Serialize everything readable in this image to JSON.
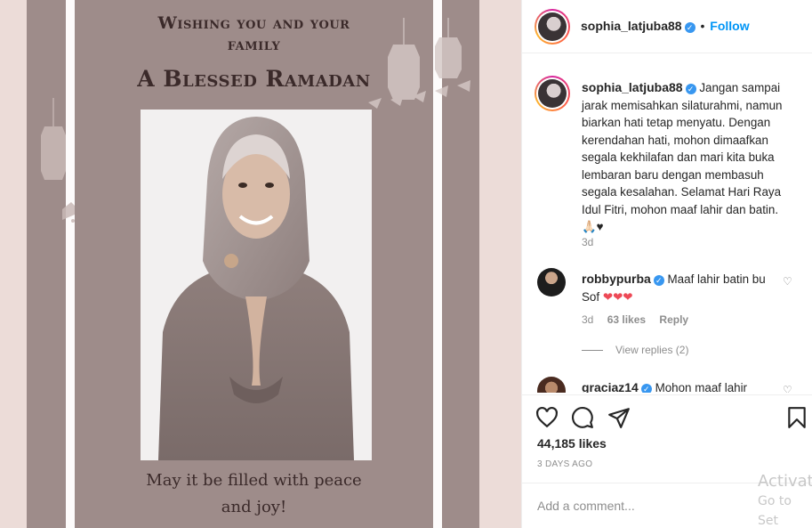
{
  "card": {
    "title_line1": "Wishing you and your",
    "title_line2": "family",
    "title_big": "A Blessed Ramadan",
    "caption_line1": "May it be filled with peace",
    "caption_line2": "and joy!"
  },
  "header": {
    "username": "sophia_latjuba88",
    "separator": "•",
    "follow_label": "Follow"
  },
  "caption": {
    "username": "sophia_latjuba88",
    "text": "Jangan sampai jarak memisahkan silaturahmi, namun biarkan hati tetap menyatu. Dengan kerendahan hati, mohon dimaafkan segala kekhilafan dan mari kita buka lembaran baru dengan membasuh segala kesalahan. Selamat Hari Raya Idul Fitri, mohon maaf lahir dan batin.",
    "emoji": "🙏🏻♥",
    "age": "3d"
  },
  "comments": [
    {
      "username": "robbypurba",
      "text": "Maaf lahir batin bu Sof",
      "emoji": "❤❤❤",
      "age": "3d",
      "likes": "63 likes",
      "reply_label": "Reply",
      "view_replies": "View replies (2)"
    },
    {
      "username": "graciaz14",
      "text": "Mohon maaf lahir"
    }
  ],
  "actions": {
    "likes": "44,185 likes",
    "timestamp": "3 DAYS AGO",
    "comment_placeholder": "Add a comment..."
  },
  "watermark": {
    "line1": "Activat",
    "line2": "Go to Set"
  },
  "colors": {
    "follow": "#0095f6",
    "verified": "#3897f0",
    "card_bg": "#9e8c8a",
    "heart": "#ed4956"
  }
}
